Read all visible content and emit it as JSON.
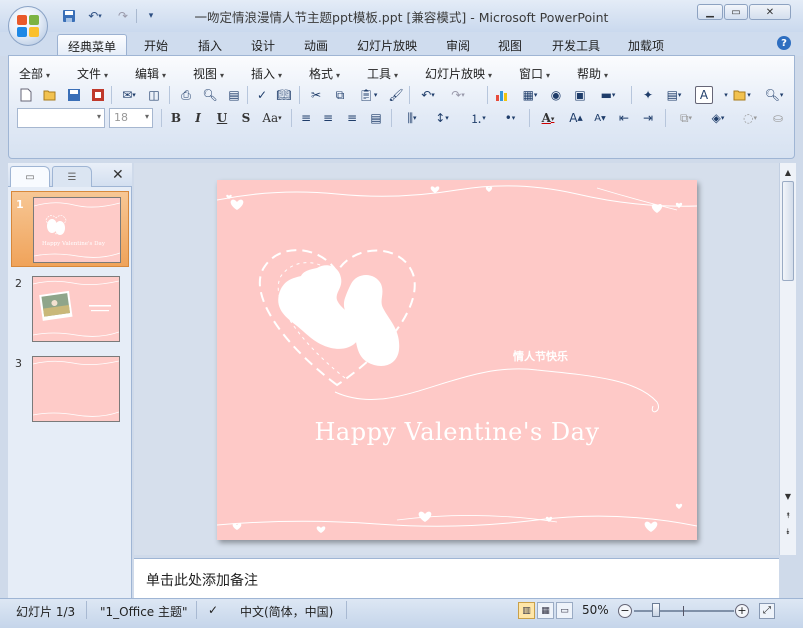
{
  "window": {
    "title": "一吻定情浪漫情人节主题ppt模板.ppt [兼容模式] - Microsoft PowerPoint",
    "minimize_icon": "minimize-icon",
    "maximize_icon": "maximize-icon",
    "close_icon": "close-icon"
  },
  "qat": {
    "save_icon": "save-icon",
    "undo_icon": "undo-icon",
    "redo_icon": "redo-icon",
    "customize_icon": "chevron-down-icon"
  },
  "tabs": [
    {
      "label": "经典菜单",
      "active": true
    },
    {
      "label": "开始"
    },
    {
      "label": "插入"
    },
    {
      "label": "设计"
    },
    {
      "label": "动画"
    },
    {
      "label": "幻灯片放映"
    },
    {
      "label": "审阅"
    },
    {
      "label": "视图"
    },
    {
      "label": "开发工具"
    },
    {
      "label": "加载项"
    }
  ],
  "menus": [
    {
      "label": "全部"
    },
    {
      "label": "文件"
    },
    {
      "label": "编辑"
    },
    {
      "label": "视图"
    },
    {
      "label": "插入"
    },
    {
      "label": "格式"
    },
    {
      "label": "工具"
    },
    {
      "label": "幻灯片放映"
    },
    {
      "label": "窗口"
    },
    {
      "label": "帮助"
    }
  ],
  "format": {
    "font_name": "",
    "font_size": "18",
    "bold": "B",
    "italic": "I",
    "underline": "U",
    "strike": "S",
    "case": "Aa",
    "font_color": "A"
  },
  "left_panel": {
    "slides": [
      {
        "number": "1",
        "selected": true,
        "thumb_text": "Happy Valentine's Day"
      },
      {
        "number": "2"
      },
      {
        "number": "3"
      }
    ]
  },
  "slide": {
    "title": "Happy Valentine's Day",
    "subtitle_cn": "情人节快乐",
    "bg_color": "#fec9c7"
  },
  "notes": {
    "placeholder": "单击此处添加备注"
  },
  "status": {
    "slide_indicator": "幻灯片 1/3",
    "theme": "\"1_Office 主题\"",
    "language": "中文(简体，中国)",
    "zoom": "50%"
  }
}
